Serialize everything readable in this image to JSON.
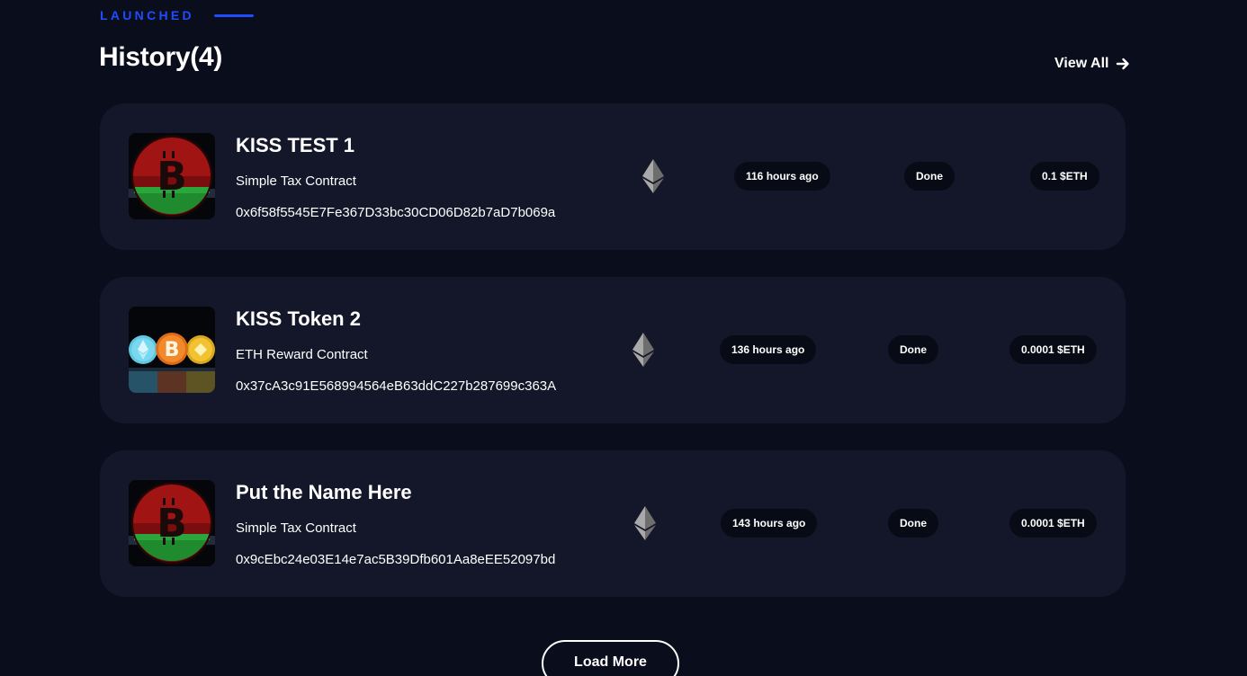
{
  "section": {
    "eyebrow": "LAUNCHED",
    "title": "History(4)",
    "view_all_label": "View All"
  },
  "colors": {
    "background": "#0a0d1c",
    "card": "#131729",
    "pill": "#080a16",
    "accent": "#1f4cff"
  },
  "tokens": [
    {
      "name": "KISS TEST 1",
      "contract_type": "Simple Tax Contract",
      "address": "0x6f58f5545E7Fe367D33bc30CD06D82b7aD7b069a",
      "chain_icon": "ethereum-icon",
      "image": "bitcoin-coin-red-green",
      "time_ago": "116 hours ago",
      "status": "Done",
      "fee": "0.1 $ETH"
    },
    {
      "name": "KISS Token 2",
      "contract_type": "ETH Reward Contract",
      "address": "0x37cA3c91E568994564eB63ddC227b287699c363A",
      "chain_icon": "ethereum-icon",
      "image": "crypto-coins-row",
      "time_ago": "136 hours ago",
      "status": "Done",
      "fee": "0.0001 $ETH"
    },
    {
      "name": "Put the Name Here",
      "contract_type": "Simple Tax Contract",
      "address": "0x9cEbc24e03E14e7ac5B39Dfb601Aa8eEE52097bd",
      "chain_icon": "ethereum-icon",
      "image": "bitcoin-coin-red-green",
      "time_ago": "143 hours ago",
      "status": "Done",
      "fee": "0.0001 $ETH"
    }
  ],
  "load_more_label": "Load More"
}
